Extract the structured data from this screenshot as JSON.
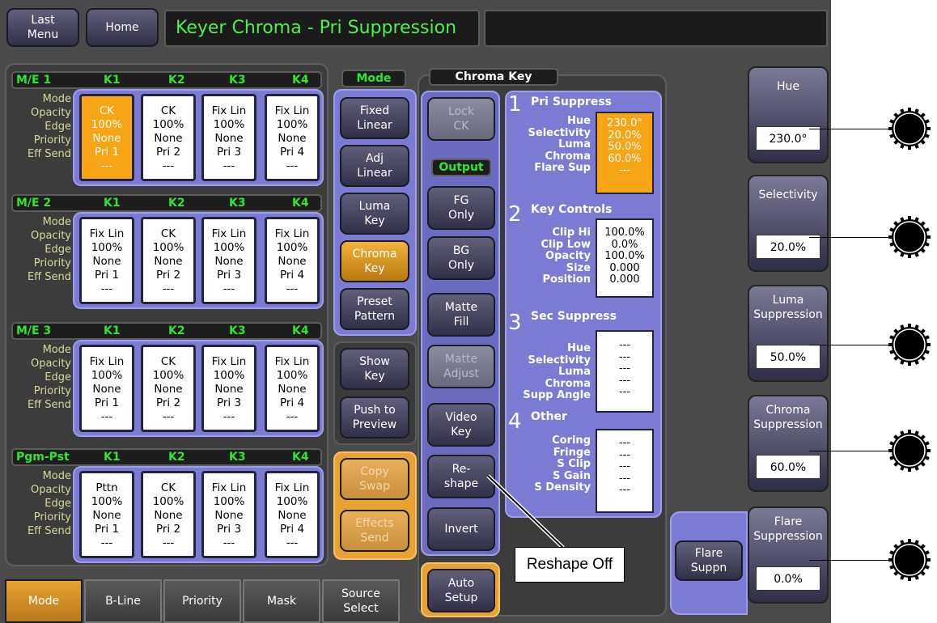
{
  "topbar": {
    "last_menu": "Last\nMenu",
    "home": "Home",
    "title": "Keyer Chroma - Pri Suppression",
    "status": ""
  },
  "row_labels": "Mode\nOpacity\nEdge\nPriority\nEff Send",
  "me_blocks": [
    {
      "name": "M/E 1",
      "keys": [
        "K1",
        "K2",
        "K3",
        "K4"
      ],
      "cells": [
        {
          "mode": "CK",
          "opacity": "100%",
          "edge": "None",
          "priority": "Pri 1",
          "eff": "---"
        },
        {
          "mode": "CK",
          "opacity": "100%",
          "edge": "None",
          "priority": "Pri 2",
          "eff": "---"
        },
        {
          "mode": "Fix Lin",
          "opacity": "100%",
          "edge": "None",
          "priority": "Pri 3",
          "eff": "---"
        },
        {
          "mode": "Fix Lin",
          "opacity": "100%",
          "edge": "None",
          "priority": "Pri 4",
          "eff": "---"
        }
      ]
    },
    {
      "name": "M/E 2",
      "keys": [
        "K1",
        "K2",
        "K3",
        "K4"
      ],
      "cells": [
        {
          "mode": "Fix Lin",
          "opacity": "100%",
          "edge": "None",
          "priority": "Pri 1",
          "eff": "---"
        },
        {
          "mode": "CK",
          "opacity": "100%",
          "edge": "None",
          "priority": "Pri 2",
          "eff": "---"
        },
        {
          "mode": "Fix Lin",
          "opacity": "100%",
          "edge": "None",
          "priority": "Pri 3",
          "eff": "---"
        },
        {
          "mode": "Fix Lin",
          "opacity": "100%",
          "edge": "None",
          "priority": "Pri 4",
          "eff": "---"
        }
      ]
    },
    {
      "name": "M/E 3",
      "keys": [
        "K1",
        "K2",
        "K3",
        "K4"
      ],
      "cells": [
        {
          "mode": "Fix Lin",
          "opacity": "100%",
          "edge": "None",
          "priority": "Pri 1",
          "eff": "---"
        },
        {
          "mode": "CK",
          "opacity": "100%",
          "edge": "None",
          "priority": "Pri 2",
          "eff": "---"
        },
        {
          "mode": "Fix Lin",
          "opacity": "100%",
          "edge": "None",
          "priority": "Pri 3",
          "eff": "---"
        },
        {
          "mode": "Fix Lin",
          "opacity": "100%",
          "edge": "None",
          "priority": "Pri 4",
          "eff": "---"
        }
      ]
    },
    {
      "name": "Pgm-Pst",
      "keys": [
        "K1",
        "K2",
        "K3",
        "K4"
      ],
      "cells": [
        {
          "mode": "Pttn",
          "opacity": "100%",
          "edge": "None",
          "priority": "Pri 1",
          "eff": "---"
        },
        {
          "mode": "CK",
          "opacity": "100%",
          "edge": "None",
          "priority": "Pri 2",
          "eff": "---"
        },
        {
          "mode": "Fix Lin",
          "opacity": "100%",
          "edge": "None",
          "priority": "Pri 3",
          "eff": "---"
        },
        {
          "mode": "Fix Lin",
          "opacity": "100%",
          "edge": "None",
          "priority": "Pri 4",
          "eff": "---"
        }
      ]
    }
  ],
  "mode_panel": {
    "title": "Mode",
    "fixed_linear": "Fixed\nLinear",
    "adj_linear": "Adj\nLinear",
    "luma_key": "Luma\nKey",
    "chroma_key": "Chroma\nKey",
    "preset_pattern": "Preset\nPattern",
    "show_key": "Show\nKey",
    "push_preview": "Push to\nPreview",
    "copy_swap": "Copy\nSwap",
    "effects_send": "Effects\nSend"
  },
  "chroma_panel": {
    "title": "Chroma Key",
    "lock_ck": "Lock\nCK",
    "output_title": "Output",
    "fg_only": "FG\nOnly",
    "bg_only": "BG\nOnly",
    "matte_fill": "Matte\nFill",
    "matte_adjust": "Matte\nAdjust",
    "video_key": "Video\nKey",
    "reshape": "Re-\nshape",
    "invert": "Invert",
    "auto_setup": "Auto\nSetup",
    "pri": {
      "num": "1",
      "title": "Pri Suppress",
      "labels": "Hue\nSelectivity\nLuma\nChroma\nFlare Sup",
      "values": "230.0°\n20.0%\n50.0%\n60.0%\n---"
    },
    "key_controls": {
      "num": "2",
      "title": "Key Controls",
      "labels": "Clip Hi\nClip Low\nOpacity\nSize\nPosition",
      "values": "100.0%\n0.0%\n100.0%\n0.000\n0.000"
    },
    "sec": {
      "num": "3",
      "title": "Sec Suppress",
      "labels": "Hue\nSelectivity\nLuma\nChroma\nSupp Angle",
      "values": "---\n---\n---\n---\n---"
    },
    "other": {
      "num": "4",
      "title": "Other",
      "labels": "Coring\nFringe\nS Clip\nS Gain\nS Density",
      "values": "---\n---\n---\n---\n---"
    }
  },
  "callout": "Reshape Off",
  "flare_suppn": "Flare\nSuppn",
  "knobs": [
    {
      "label": "Hue",
      "value": "230.0°"
    },
    {
      "label": "Selectivity",
      "value": "20.0%"
    },
    {
      "label": "Luma\nSuppression",
      "value": "50.0%"
    },
    {
      "label": "Chroma\nSuppression",
      "value": "60.0%"
    },
    {
      "label": "Flare\nSuppression",
      "value": "0.0%"
    }
  ],
  "bottom_tabs": [
    "Mode",
    "B-Line",
    "Priority",
    "Mask",
    "Source\nSelect"
  ],
  "colors": {
    "selected_orange": "#f7a415",
    "group_purple": "#7b7bd3",
    "header_green": "#2ee62e"
  }
}
